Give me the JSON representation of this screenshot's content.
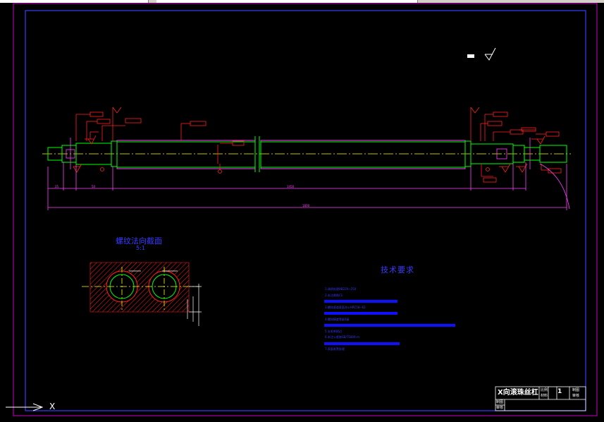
{
  "colors": {
    "background": "#000000",
    "frame": "#3a3aff",
    "outer_frame": "#c800c8",
    "shaft": "#00ff00",
    "centerline": "#ffff00",
    "dimension": "#c800c8",
    "annotation": "#ff0000",
    "hatch": "#ff0000",
    "text": "#3a3aff",
    "titleblock": "#ffffff"
  },
  "section_view": {
    "title": "螺纹法向截面",
    "scale": "5:1"
  },
  "tech_requirements": {
    "title": "技术要求",
    "lines": [
      "1.调质处理HB220~250",
      "2.未注倒角C1",
      "3.螺纹滚道表面淬火HRC58~62",
      "4.螺纹精度等级5级",
      "5.去毛刺锐边",
      "6.未注公差按GB/T1804-m",
      "7.表面发黑处理"
    ]
  },
  "title_block": {
    "part_name": "X向滚珠丝杠",
    "scale_label": "比例",
    "material_label": "材料",
    "drawn_label": "制图",
    "checked_label": "审核",
    "sheet_value": "1"
  },
  "dimensions": {
    "total_length": "1800",
    "thread_length": "1450"
  },
  "ucs_icon": "ucs-icon"
}
